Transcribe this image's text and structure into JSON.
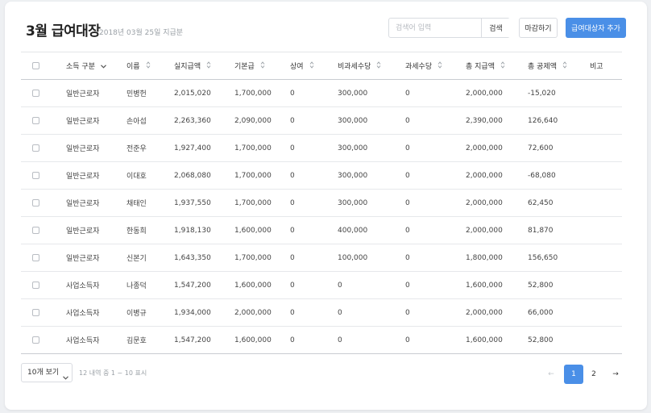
{
  "header": {
    "title": "3월 급여대장",
    "subtitle": "2018년 03월 25일 지급분",
    "search_placeholder": "검색어 입력",
    "search_value": "",
    "search_button": "검색",
    "close_button": "마감하기",
    "add_button": "급여대상자 추가"
  },
  "table": {
    "columns": [
      "소득 구분",
      "이름",
      "실지급액",
      "기본급",
      "상여",
      "비과세수당",
      "과세수당",
      "총 지급액",
      "총 공제액",
      "비고"
    ],
    "rows": [
      [
        "일반근로자",
        "민병헌",
        "2,015,020",
        "1,700,000",
        "0",
        "300,000",
        "0",
        "2,000,000",
        "-15,020",
        ""
      ],
      [
        "일반근로자",
        "손아섭",
        "2,263,360",
        "2,090,000",
        "0",
        "300,000",
        "0",
        "2,390,000",
        "126,640",
        ""
      ],
      [
        "일반근로자",
        "전준우",
        "1,927,400",
        "1,700,000",
        "0",
        "300,000",
        "0",
        "2,000,000",
        "72,600",
        ""
      ],
      [
        "일반근로자",
        "이대호",
        "2,068,080",
        "1,700,000",
        "0",
        "300,000",
        "0",
        "2,000,000",
        "-68,080",
        ""
      ],
      [
        "일반근로자",
        "채태인",
        "1,937,550",
        "1,700,000",
        "0",
        "300,000",
        "0",
        "2,000,000",
        "62,450",
        ""
      ],
      [
        "일반근로자",
        "한동희",
        "1,918,130",
        "1,600,000",
        "0",
        "400,000",
        "0",
        "2,000,000",
        "81,870",
        ""
      ],
      [
        "일반근로자",
        "신본기",
        "1,643,350",
        "1,700,000",
        "0",
        "100,000",
        "0",
        "1,800,000",
        "156,650",
        ""
      ],
      [
        "사업소득자",
        "나종덕",
        "1,547,200",
        "1,600,000",
        "0",
        "0",
        "0",
        "1,600,000",
        "52,800",
        ""
      ],
      [
        "사업소득자",
        "이병규",
        "1,934,000",
        "2,000,000",
        "0",
        "0",
        "0",
        "2,000,000",
        "66,000",
        ""
      ],
      [
        "사업소득자",
        "김문호",
        "1,547,200",
        "1,600,000",
        "0",
        "0",
        "0",
        "1,600,000",
        "52,800",
        ""
      ]
    ]
  },
  "footer": {
    "page_size": "10개 보기",
    "page_info": "12 내역 중 1 ~ 10 표시",
    "prev_arrow": "←",
    "next_arrow": "→",
    "pages": [
      "1",
      "2"
    ],
    "current_page": 1
  },
  "colors": {
    "accent": "#4a8fe7",
    "border": "#d9dce1"
  },
  "icons": {
    "first_column_sort": "chevron-down-icon",
    "other_columns_sort": "sort-updown-icon"
  }
}
